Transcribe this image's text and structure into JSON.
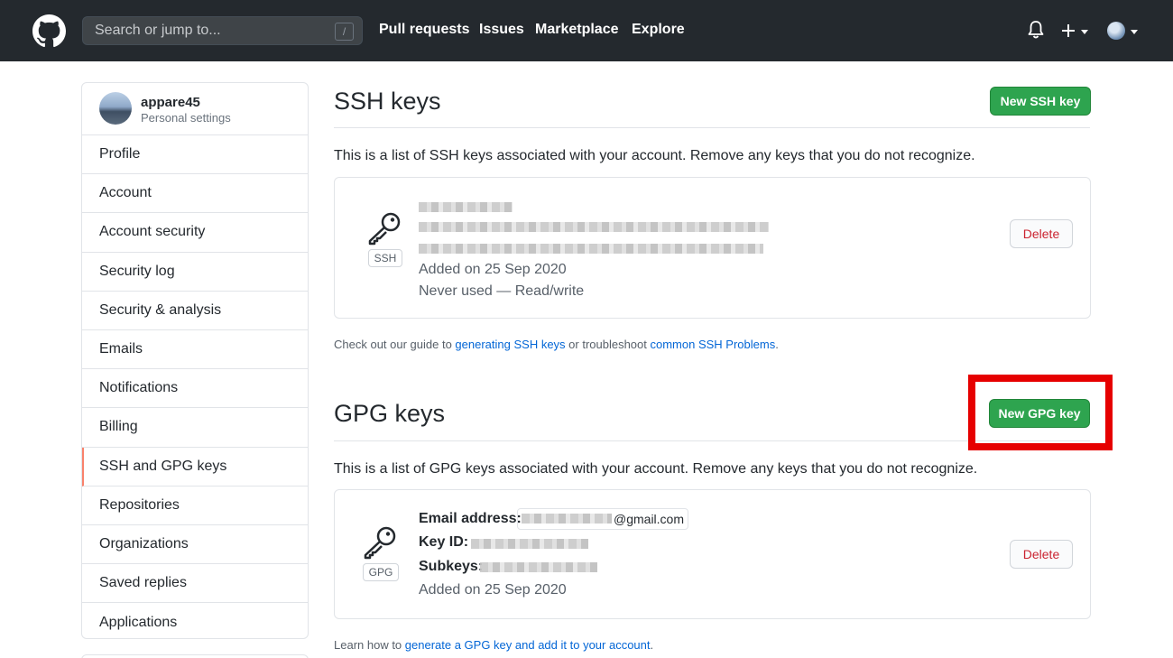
{
  "header": {
    "search_placeholder": "Search or jump to...",
    "search_shortcut": "/",
    "nav": [
      "Pull requests",
      "Issues",
      "Marketplace",
      "Explore"
    ],
    "plus_label": "+"
  },
  "sidebar": {
    "username": "appare45",
    "subtitle": "Personal settings",
    "items": [
      {
        "label": "Profile"
      },
      {
        "label": "Account"
      },
      {
        "label": "Account security"
      },
      {
        "label": "Security log"
      },
      {
        "label": "Security & analysis"
      },
      {
        "label": "Emails"
      },
      {
        "label": "Notifications"
      },
      {
        "label": "Billing"
      },
      {
        "label": "SSH and GPG keys",
        "selected": true
      },
      {
        "label": "Repositories"
      },
      {
        "label": "Organizations"
      },
      {
        "label": "Saved replies"
      },
      {
        "label": "Applications"
      }
    ]
  },
  "ssh": {
    "title": "SSH keys",
    "new_button": "New SSH key",
    "description": "This is a list of SSH keys associated with your account. Remove any keys that you do not recognize.",
    "key": {
      "type_label": "SSH",
      "added": "Added on 25 Sep 2020",
      "usage": "Never used — Read/write",
      "delete_label": "Delete"
    },
    "help_prefix": "Check out our guide to ",
    "help_link1": "generating SSH keys",
    "help_middle": " or troubleshoot ",
    "help_link2": "common SSH Problems",
    "help_suffix": "."
  },
  "gpg": {
    "title": "GPG keys",
    "new_button": "New GPG key",
    "description": "This is a list of GPG keys associated with your account. Remove any keys that you do not recognize.",
    "key": {
      "type_label": "GPG",
      "email_label": "Email address:",
      "email_domain": "@gmail.com",
      "keyid_label": "Key ID:",
      "subkeys_label": "Subkeys:",
      "added": "Added on 25 Sep 2020",
      "delete_label": "Delete"
    },
    "help_prefix": "Learn how to ",
    "help_link": "generate a GPG key and add it to your account",
    "help_suffix": "."
  },
  "colors": {
    "header_bg": "#24292e",
    "primary_green": "#2ea44f",
    "danger_red": "#cb2431",
    "link_blue": "#0366d6",
    "selected_marker": "#f9826c",
    "annotation_red": "#e60000"
  }
}
